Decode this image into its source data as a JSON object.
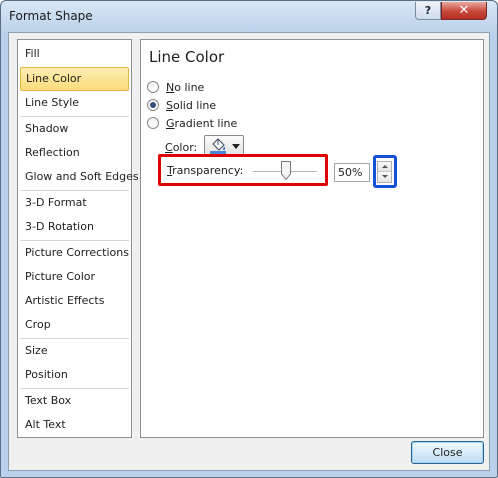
{
  "window": {
    "title": "Format Shape"
  },
  "titlebar_buttons": {
    "help": "?",
    "close": "✕"
  },
  "nav": {
    "items": [
      "Fill",
      "Line Color",
      "Line Style",
      "Shadow",
      "Reflection",
      "Glow and Soft Edges",
      "3-D Format",
      "3-D Rotation",
      "Picture Corrections",
      "Picture Color",
      "Artistic Effects",
      "Crop",
      "Size",
      "Position",
      "Text Box",
      "Alt Text"
    ],
    "selected": "Line Color"
  },
  "panel": {
    "title": "Line Color",
    "options": {
      "no_line": {
        "access_key": "N",
        "rest": "o line"
      },
      "solid_line": {
        "access_key": "S",
        "rest": "olid line"
      },
      "gradient_line": {
        "access_key": "G",
        "rest": "radient line"
      }
    },
    "selected_option": "Solid line",
    "color": {
      "access_key": "C",
      "rest": "olor:",
      "icon": "paint-bucket-icon"
    },
    "transparency": {
      "access_key": "T",
      "rest": "ransparency:",
      "value": "50%",
      "level": 0.5
    }
  },
  "footer": {
    "close_label": "Close"
  },
  "colors": {
    "highlight_red": "#e00000",
    "highlight_blue": "#1450d8",
    "selected_item": "#fcdb7a"
  }
}
